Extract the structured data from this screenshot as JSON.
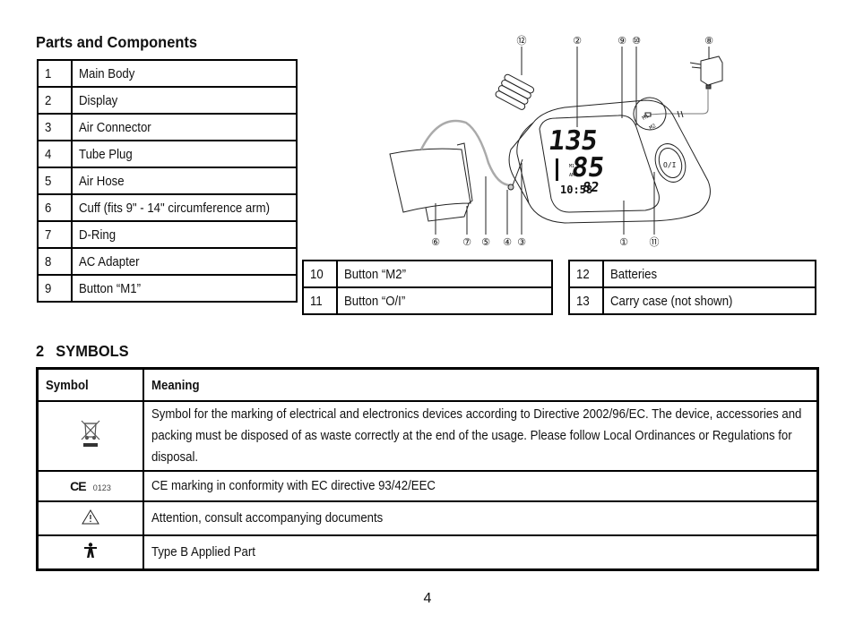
{
  "parts_section": {
    "title": "Parts and Components",
    "left_table": [
      {
        "num": "1",
        "label": "Main Body"
      },
      {
        "num": "2",
        "label": "Display"
      },
      {
        "num": "3",
        "label": "Air Connector"
      },
      {
        "num": "4",
        "label": "Tube Plug"
      },
      {
        "num": "5",
        "label": "Air Hose"
      },
      {
        "num": "6",
        "label": "Cuff (fits 9\" - 14\" circumference arm)"
      },
      {
        "num": "7",
        "label": "D-Ring"
      },
      {
        "num": "8",
        "label": "AC Adapter"
      },
      {
        "num": "9",
        "label": "Button “M1”"
      }
    ],
    "middle_table": [
      {
        "num": "10",
        "label": "Button “M2”"
      },
      {
        "num": "11",
        "label": "Button “O/I”"
      }
    ],
    "right_table": [
      {
        "num": "12",
        "label": "Batteries"
      },
      {
        "num": "13",
        "label": "Carry case (not shown)"
      }
    ]
  },
  "diagram": {
    "callouts": [
      "⑫",
      "②",
      "⑨",
      "⑩",
      "⑧",
      "⑥",
      "⑦",
      "⑤",
      "④",
      "③",
      "①",
      "⑪"
    ],
    "display": {
      "systolic": "135",
      "diastolic": "85",
      "pulse": "82",
      "time": "10:58",
      "memory": "M1",
      "period": "AM"
    },
    "buttons": {
      "m1": "M1",
      "m2": "M2",
      "power": "O/I"
    }
  },
  "symbols_section": {
    "number": "2",
    "title": "SYMBOLS",
    "headers": {
      "symbol": "Symbol",
      "meaning": "Meaning"
    },
    "rows": [
      {
        "icon": "weee-crossed-bin-icon",
        "meaning": "Symbol for the marking of electrical and electronics devices according to Directive 2002/96/EC. The device, accessories and packing must be disposed of as waste correctly at the end of the usage. Please follow Local Ordinances or Regulations for disposal."
      },
      {
        "icon": "ce-mark-icon",
        "symbol_text": "CE",
        "symbol_code": "0123",
        "meaning": "CE marking in conformity with EC directive 93/42/EEC"
      },
      {
        "icon": "attention-warning-icon",
        "meaning": "Attention, consult accompanying documents"
      },
      {
        "icon": "type-b-applied-part-icon",
        "meaning": "Type B Applied Part"
      }
    ]
  },
  "page_number": "4"
}
